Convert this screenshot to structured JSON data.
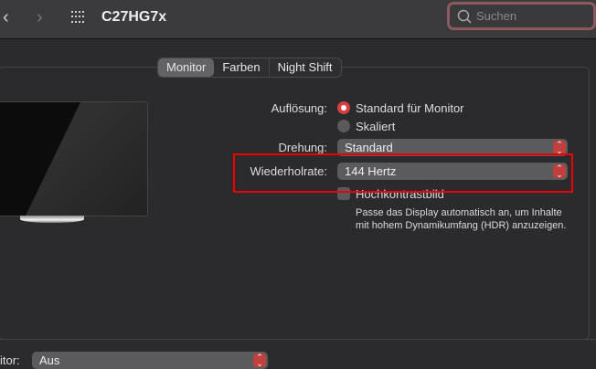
{
  "toolbar": {
    "back": "‹",
    "forward": "›",
    "title": "C27HG7x",
    "search_placeholder": "Suchen"
  },
  "tabs": [
    {
      "label": "Monitor",
      "active": true
    },
    {
      "label": "Farben"
    },
    {
      "label": "Night Shift"
    }
  ],
  "settings": {
    "resolution_label": "Auflösung:",
    "resolution_options": [
      {
        "label": "Standard für Monitor",
        "selected": true
      },
      {
        "label": "Skaliert",
        "selected": false
      }
    ],
    "rotation_label": "Drehung:",
    "rotation_value": "Standard",
    "refresh_label": "Wiederholrate:",
    "refresh_value": "144 Hertz",
    "hdr_label": "Hochkontrastbild",
    "hdr_checked": false,
    "hdr_description": "Passe das Display automatisch an, um Inhalte mit hohem Dynamikumfang (HDR) anzuzeigen."
  },
  "bottom": {
    "label": "itor:",
    "value": "Aus"
  },
  "colors": {
    "accent": "#d7403e",
    "highlight": "#ee0000"
  }
}
